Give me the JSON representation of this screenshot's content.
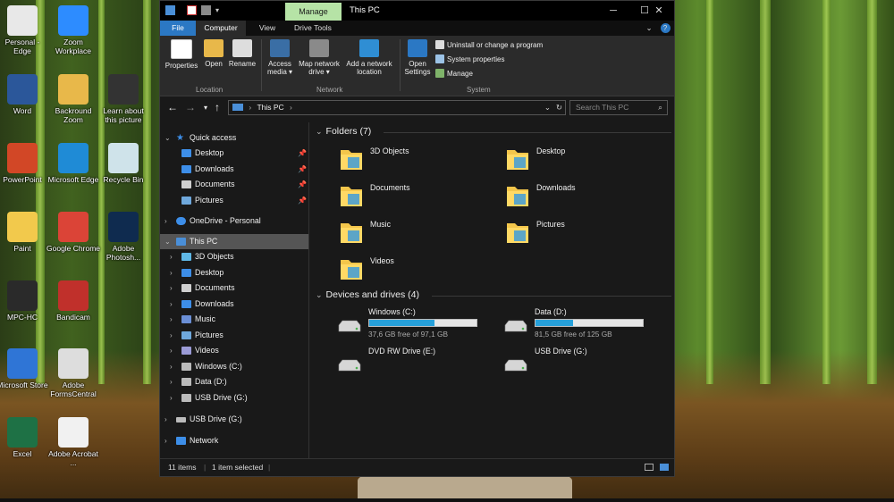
{
  "desktop": {
    "icons": [
      {
        "label": "Personal - Edge",
        "icon": "file-icon",
        "color": "#e8e8e8"
      },
      {
        "label": "Zoom Workplace",
        "icon": "zoom-icon",
        "color": "#2d8cff"
      },
      {
        "label": "Word",
        "icon": "word-icon",
        "color": "#2b579a"
      },
      {
        "label": "Backround Zoom",
        "icon": "folder-icon",
        "color": "#e8b84a"
      },
      {
        "label": "Learn about this picture",
        "icon": "camera-icon",
        "color": "#333333"
      },
      {
        "label": "PowerPoint",
        "icon": "powerpoint-icon",
        "color": "#d24726"
      },
      {
        "label": "Microsoft Edge",
        "icon": "edge-icon",
        "color": "#1f8bd6"
      },
      {
        "label": "Recycle Bin",
        "icon": "recycle-bin-icon",
        "color": "#cfe3ea"
      },
      {
        "label": "Paint",
        "icon": "paint-icon",
        "color": "#f2c94c"
      },
      {
        "label": "Google Chrome",
        "icon": "chrome-icon",
        "color": "#db4437"
      },
      {
        "label": "Adobe Photosh...",
        "icon": "photoshop-icon",
        "color": "#0f2b4f"
      },
      {
        "label": "MPC-HC",
        "icon": "mpc-icon",
        "color": "#2a2a2a"
      },
      {
        "label": "Bandicam",
        "icon": "bandicam-icon",
        "color": "#c0302b"
      },
      {
        "label": "Microsoft Store",
        "icon": "store-icon",
        "color": "#2f75d6"
      },
      {
        "label": "Adobe FormsCentral",
        "icon": "forms-icon",
        "color": "#dddddd"
      },
      {
        "label": "Excel",
        "icon": "excel-icon",
        "color": "#1e7145"
      },
      {
        "label": "Adobe Acrobat ...",
        "icon": "acrobat-icon",
        "color": "#f1f1f1"
      }
    ]
  },
  "window": {
    "title": "This PC",
    "manage_tab": "Manage",
    "controls": {
      "minimize": "─",
      "maximize": "☐",
      "close": "✕"
    },
    "tabs": {
      "file": "File",
      "computer": "Computer",
      "view": "View",
      "drive_tools": "Drive Tools"
    },
    "ribbon": {
      "properties": "Properties",
      "open": "Open",
      "rename": "Rename",
      "access_media": "Access media ▾",
      "map_network_drive": "Map network drive ▾",
      "add_network_location": "Add a network location",
      "open_settings": "Open Settings",
      "uninstall": "Uninstall or change a program",
      "system_properties": "System properties",
      "manage": "Manage",
      "group_location": "Location",
      "group_network": "Network",
      "group_system": "System"
    },
    "address": {
      "back": "←",
      "forward": "→",
      "recent": "▾",
      "up": "↑",
      "path": "This PC",
      "search_placeholder": "Search This PC"
    },
    "nav": {
      "quick_access": "Quick access",
      "qa_items": [
        "Desktop",
        "Downloads",
        "Documents",
        "Pictures"
      ],
      "onedrive": "OneDrive - Personal",
      "this_pc": "This PC",
      "pc_items": [
        "3D Objects",
        "Desktop",
        "Documents",
        "Downloads",
        "Music",
        "Pictures",
        "Videos",
        "Windows (C:)",
        "Data (D:)",
        "USB Drive (G:)"
      ],
      "usb": "USB Drive (G:)",
      "network": "Network"
    },
    "folders": {
      "heading": "Folders (7)",
      "items": [
        "3D Objects",
        "Desktop",
        "Documents",
        "Downloads",
        "Music",
        "Pictures",
        "Videos"
      ]
    },
    "drives": {
      "heading": "Devices and drives (4)",
      "items": [
        {
          "name": "Windows (C:)",
          "free": "37,6 GB free of 97,1 GB",
          "used_fraction": 0.61
        },
        {
          "name": "Data (D:)",
          "free": "81,5 GB free of 125 GB",
          "used_fraction": 0.35
        },
        {
          "name": "DVD RW Drive (E:)"
        },
        {
          "name": "USB Drive (G:)"
        }
      ]
    },
    "status": {
      "items": "11 items",
      "selected": "1 item selected"
    }
  }
}
